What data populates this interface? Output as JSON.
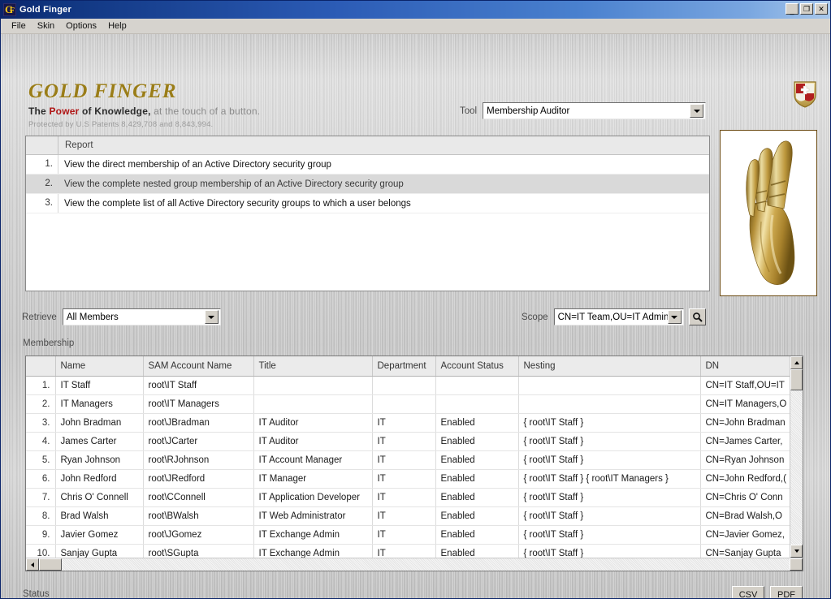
{
  "window": {
    "title": "Gold Finger",
    "icon": "gold-finger-logo-icon",
    "minimize_label": "_",
    "maximize_label": "❐",
    "close_label": "✕"
  },
  "menu": {
    "items": [
      {
        "label": "File"
      },
      {
        "label": "Skin"
      },
      {
        "label": "Options"
      },
      {
        "label": "Help"
      }
    ]
  },
  "brand": {
    "title": "GOLD FINGER",
    "tagline_pre": "The ",
    "tagline_power": "Power",
    "tagline_mid": " of Knowledge,",
    "tagline_rest": " at the touch of a button.",
    "patent": "Protected by U.S Patents 8,429,708 and 8,843,994.",
    "gold_color": "#9a7d18",
    "power_color": "#b01515"
  },
  "tool": {
    "label": "Tool",
    "value": "Membership Auditor"
  },
  "report": {
    "header": "Report",
    "selected_index": 2,
    "rows": [
      {
        "num": "1.",
        "text": "View the direct membership of an Active Directory security group"
      },
      {
        "num": "2.",
        "text": "View the complete nested group membership of an Active Directory security group"
      },
      {
        "num": "3.",
        "text": "View the complete list of all Active Directory security groups to which a user belongs"
      }
    ]
  },
  "retrieve": {
    "label": "Retrieve",
    "value": "All Members"
  },
  "scope": {
    "label": "Scope",
    "value": "CN=IT Team,OU=IT Admin",
    "search_icon": "search-icon"
  },
  "membership": {
    "label": "Membership",
    "columns": [
      "",
      "Name",
      "SAM Account Name",
      "Title",
      "Department",
      "Account Status",
      "Nesting",
      "DN"
    ],
    "rows": [
      {
        "num": "1.",
        "name": "IT Staff",
        "sam": "root\\IT Staff",
        "title": "",
        "dept": "",
        "status": "",
        "nesting": "",
        "dn": "CN=IT Staff,OU=IT"
      },
      {
        "num": "2.",
        "name": "IT Managers",
        "sam": "root\\IT Managers",
        "title": "",
        "dept": "",
        "status": "",
        "nesting": "",
        "dn": "CN=IT Managers,O"
      },
      {
        "num": "3.",
        "name": "John Bradman",
        "sam": "root\\JBradman",
        "title": "IT Auditor",
        "dept": "IT",
        "status": "Enabled",
        "nesting": "{ root\\IT Staff }",
        "dn": "CN=John Bradman"
      },
      {
        "num": "4.",
        "name": "James Carter",
        "sam": "root\\JCarter",
        "title": "IT Auditor",
        "dept": "IT",
        "status": "Enabled",
        "nesting": "{ root\\IT Staff }",
        "dn": "CN=James Carter,"
      },
      {
        "num": "5.",
        "name": "Ryan Johnson",
        "sam": "root\\RJohnson",
        "title": "IT Account Manager",
        "dept": "IT",
        "status": "Enabled",
        "nesting": "{ root\\IT Staff }",
        "dn": "CN=Ryan Johnson"
      },
      {
        "num": "6.",
        "name": "John Redford",
        "sam": "root\\JRedford",
        "title": "IT Manager",
        "dept": "IT",
        "status": "Enabled",
        "nesting": "{ root\\IT Staff }  { root\\IT Managers }",
        "dn": "CN=John Redford,("
      },
      {
        "num": "7.",
        "name": "Chris O' Connell",
        "sam": "root\\CConnell",
        "title": "IT Application Developer",
        "dept": "IT",
        "status": "Enabled",
        "nesting": "{ root\\IT Staff }",
        "dn": "CN=Chris O' Conn"
      },
      {
        "num": "8.",
        "name": "Brad Walsh",
        "sam": "root\\BWalsh",
        "title": "IT Web Administrator",
        "dept": "IT",
        "status": "Enabled",
        "nesting": "{ root\\IT Staff }",
        "dn": "CN=Brad Walsh,O"
      },
      {
        "num": "9.",
        "name": "Javier Gomez",
        "sam": "root\\JGomez",
        "title": "IT Exchange Admin",
        "dept": "IT",
        "status": "Enabled",
        "nesting": "{ root\\IT Staff }",
        "dn": "CN=Javier Gomez,"
      },
      {
        "num": "10.",
        "name": "Sanjay Gupta",
        "sam": "root\\SGupta",
        "title": "IT Exchange Admin",
        "dept": "IT",
        "status": "Enabled",
        "nesting": "{ root\\IT Staff }",
        "dn": "CN=Sanjay Gupta"
      }
    ]
  },
  "status": {
    "label": "Status"
  },
  "export": {
    "csv_label": "CSV",
    "pdf_label": "PDF"
  }
}
